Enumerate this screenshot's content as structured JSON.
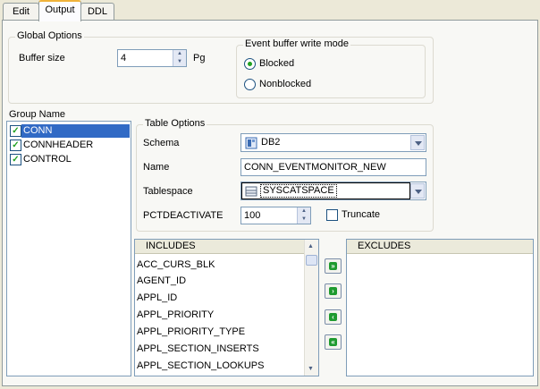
{
  "tabs": [
    {
      "label": "Edit",
      "underline_first": "E"
    },
    {
      "label": "Output"
    },
    {
      "label": "DDL"
    }
  ],
  "global_options": {
    "title": "Global Options",
    "buffer_size_label": "Buffer size",
    "buffer_size_value": "4",
    "buffer_size_unit": "Pg",
    "write_mode": {
      "title": "Event buffer write mode",
      "options": [
        "Blocked",
        "Nonblocked"
      ],
      "selected": "Blocked"
    }
  },
  "group_name": {
    "title": "Group Name",
    "items": [
      {
        "label": "CONN",
        "checked": true,
        "selected": true
      },
      {
        "label": "CONNHEADER",
        "checked": true,
        "selected": false
      },
      {
        "label": "CONTROL",
        "checked": true,
        "selected": false
      }
    ]
  },
  "table_options": {
    "title": "Table Options",
    "schema_label": "Schema",
    "schema_value": "DB2",
    "name_label": "Name",
    "name_value": "CONN_EVENTMONITOR_NEW",
    "tablespace_label": "Tablespace",
    "tablespace_value": "SYSCATSPACE",
    "pctdeactivate_label": "PCTDEACTIVATE",
    "pctdeactivate_value": "100",
    "truncate_label": "Truncate",
    "truncate_checked": false
  },
  "includes": {
    "header": "INCLUDES",
    "items": [
      "ACC_CURS_BLK",
      "AGENT_ID",
      "APPL_ID",
      "APPL_PRIORITY",
      "APPL_PRIORITY_TYPE",
      "APPL_SECTION_INSERTS",
      "APPL_SECTION_LOOKUPS"
    ]
  },
  "excludes": {
    "header": "EXCLUDES",
    "items": []
  },
  "move_buttons": [
    {
      "name": "include-all-button",
      "glyph": "»"
    },
    {
      "name": "include-one-button",
      "glyph": "›"
    },
    {
      "name": "exclude-one-button",
      "glyph": "‹"
    },
    {
      "name": "exclude-all-button",
      "glyph": "«"
    }
  ],
  "colors": {
    "accent": "#316ac5",
    "arrow_green": "#1e9a2e"
  }
}
